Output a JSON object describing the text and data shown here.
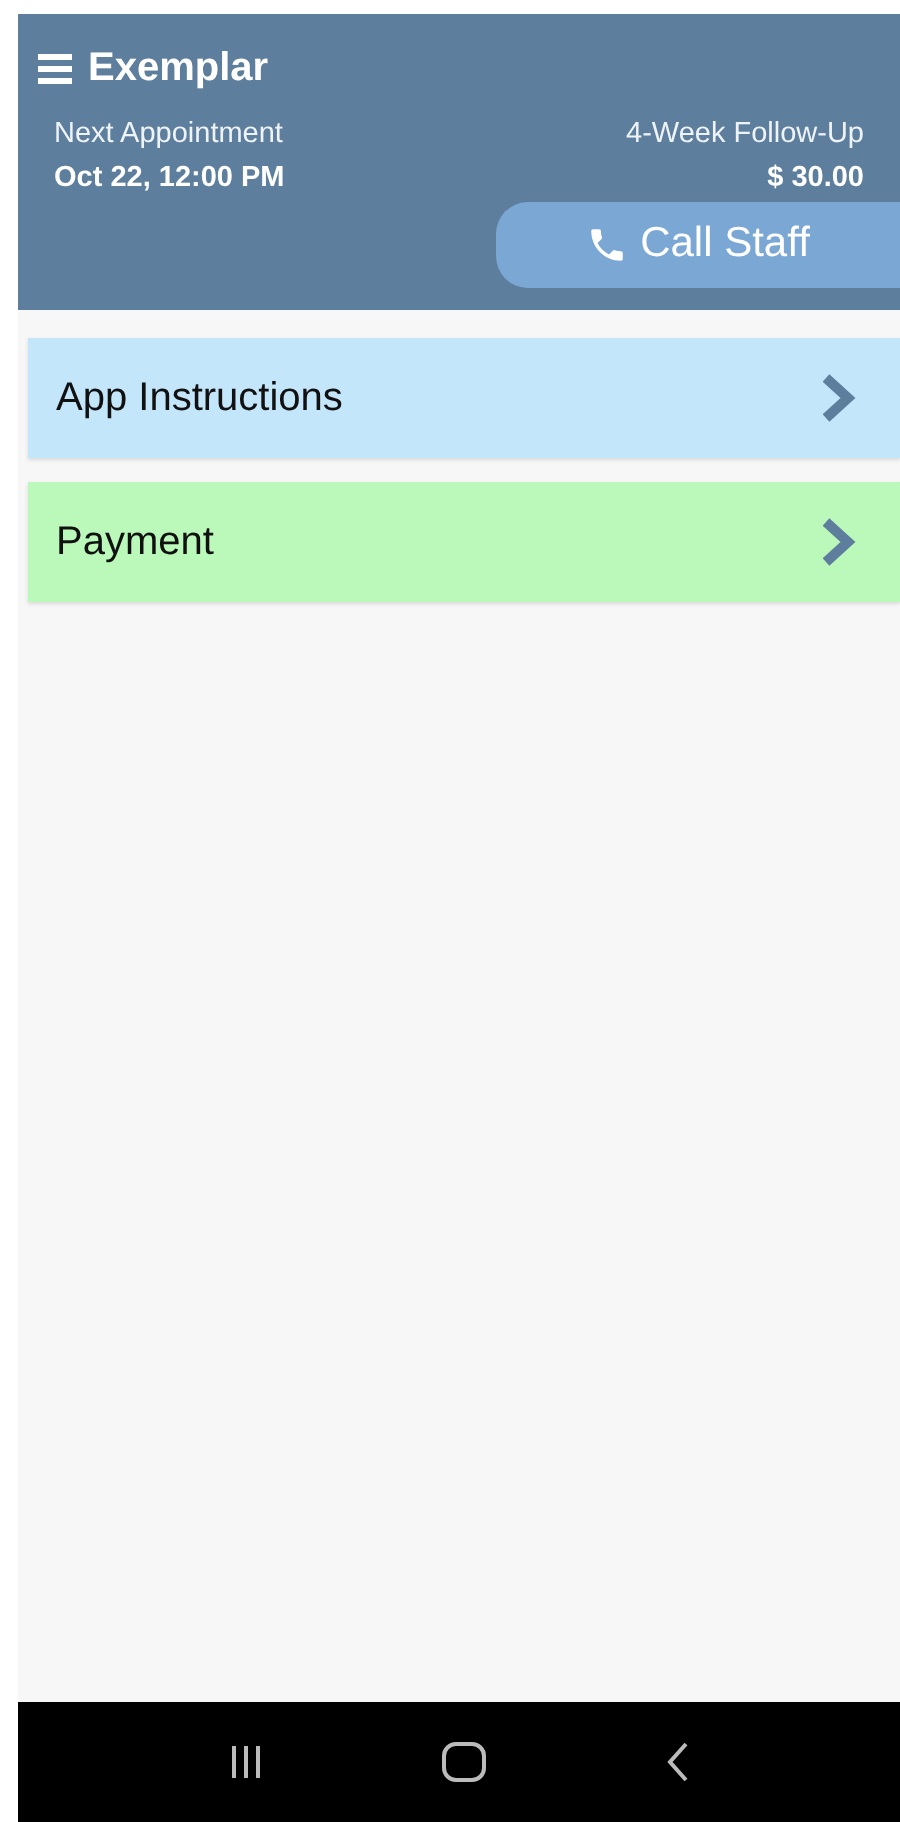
{
  "header": {
    "title": "Exemplar",
    "appointment_label": "Next Appointment",
    "appointment_time": "Oct 22, 12:00 PM",
    "visit_type": "4-Week Follow-Up",
    "price": "$ 30.00",
    "call_button": "Call Staff"
  },
  "menu_items": [
    {
      "label": "App Instructions",
      "color": "#c4e6fb"
    },
    {
      "label": "Payment",
      "color": "#baf9b9"
    }
  ]
}
